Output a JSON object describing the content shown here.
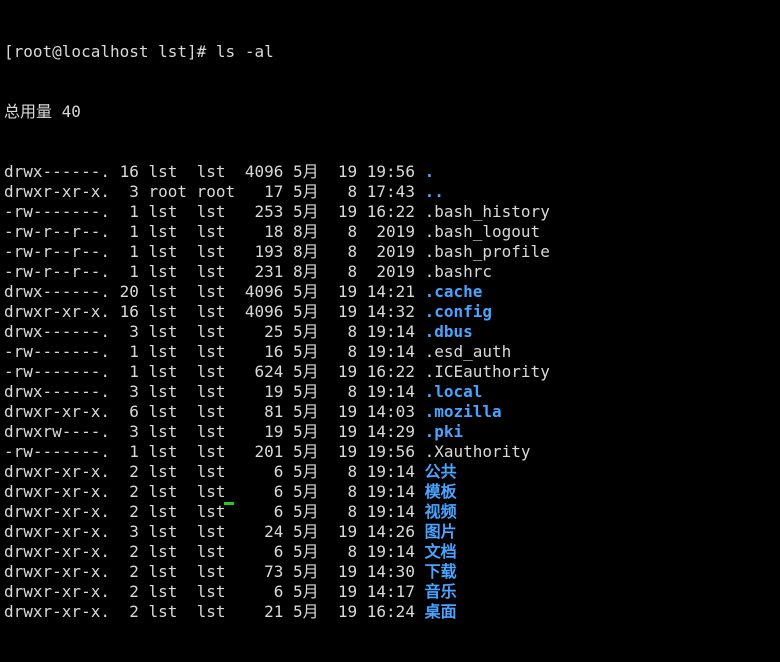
{
  "terminal": {
    "prompt": "[root@localhost lst]# ",
    "command": "ls -al",
    "total_line": "总用量 40",
    "colors": {
      "text": "#d9d9d9",
      "directory": "#4aa3ff",
      "background": "#000000",
      "cursor": "#22cc22"
    },
    "entries": [
      {
        "meta": "drwx------. 16 lst  lst  4096 5月  19 19:56 ",
        "name": ".",
        "is_dir": true
      },
      {
        "meta": "drwxr-xr-x.  3 root root   17 5月   8 17:43 ",
        "name": "..",
        "is_dir": true
      },
      {
        "meta": "-rw-------.  1 lst  lst   253 5月  19 16:22 ",
        "name": ".bash_history",
        "is_dir": false
      },
      {
        "meta": "-rw-r--r--.  1 lst  lst    18 8月   8  2019 ",
        "name": ".bash_logout",
        "is_dir": false
      },
      {
        "meta": "-rw-r--r--.  1 lst  lst   193 8月   8  2019 ",
        "name": ".bash_profile",
        "is_dir": false
      },
      {
        "meta": "-rw-r--r--.  1 lst  lst   231 8月   8  2019 ",
        "name": ".bashrc",
        "is_dir": false
      },
      {
        "meta": "drwx------. 20 lst  lst  4096 5月  19 14:21 ",
        "name": ".cache",
        "is_dir": true
      },
      {
        "meta": "drwxr-xr-x. 16 lst  lst  4096 5月  19 14:32 ",
        "name": ".config",
        "is_dir": true
      },
      {
        "meta": "drwx------.  3 lst  lst    25 5月   8 19:14 ",
        "name": ".dbus",
        "is_dir": true
      },
      {
        "meta": "-rw-------.  1 lst  lst    16 5月   8 19:14 ",
        "name": ".esd_auth",
        "is_dir": false
      },
      {
        "meta": "-rw-------.  1 lst  lst   624 5月  19 16:22 ",
        "name": ".ICEauthority",
        "is_dir": false
      },
      {
        "meta": "drwx------.  3 lst  lst    19 5月   8 19:14 ",
        "name": ".local",
        "is_dir": true
      },
      {
        "meta": "drwxr-xr-x.  6 lst  lst    81 5月  19 14:03 ",
        "name": ".mozilla",
        "is_dir": true
      },
      {
        "meta": "drwxrw----.  3 lst  lst    19 5月  19 14:29 ",
        "name": ".pki",
        "is_dir": true
      },
      {
        "meta": "-rw-------.  1 lst  lst   201 5月  19 19:56 ",
        "name": ".Xauthority",
        "is_dir": false
      },
      {
        "meta": "drwxr-xr-x.  2 lst  lst     6 5月   8 19:14 ",
        "name": "公共",
        "is_dir": true
      },
      {
        "meta": "drwxr-xr-x.  2 lst  lst     6 5月   8 19:14 ",
        "name": "模板",
        "is_dir": true
      },
      {
        "meta": "drwxr-xr-x.  2 lst  lst     6 5月   8 19:14 ",
        "name": "视频",
        "is_dir": true
      },
      {
        "meta": "drwxr-xr-x.  3 lst  lst    24 5月  19 14:26 ",
        "name": "图片",
        "is_dir": true
      },
      {
        "meta": "drwxr-xr-x.  2 lst  lst     6 5月   8 19:14 ",
        "name": "文档",
        "is_dir": true
      },
      {
        "meta": "drwxr-xr-x.  2 lst  lst    73 5月  19 14:30 ",
        "name": "下载",
        "is_dir": true
      },
      {
        "meta": "drwxr-xr-x.  2 lst  lst     6 5月  19 14:17 ",
        "name": "音乐",
        "is_dir": true
      },
      {
        "meta": "drwxr-xr-x.  2 lst  lst    21 5月  19 16:24 ",
        "name": "桌面",
        "is_dir": true
      }
    ]
  }
}
